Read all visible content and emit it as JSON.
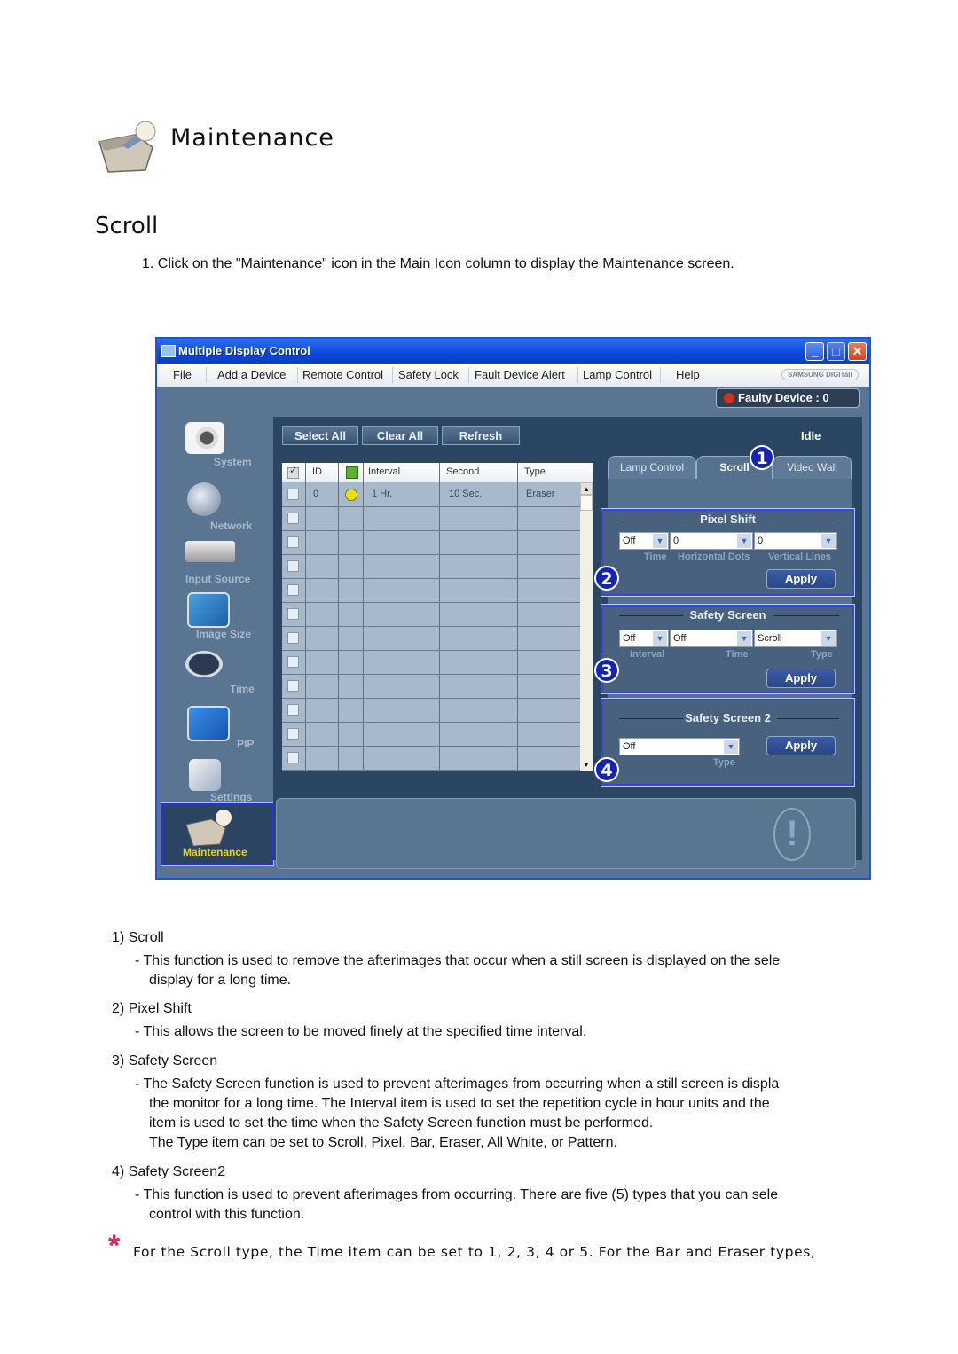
{
  "page": {
    "header_title": "Maintenance",
    "section_title": "Scroll",
    "step1": "1. Click on the \"Maintenance\" icon in the Main Icon column to display the Maintenance screen."
  },
  "window": {
    "title": "Multiple Display Control",
    "controls": {
      "minimize": "_",
      "maximize": "□",
      "close": "✕"
    },
    "menu": [
      "File",
      "Add a Device",
      "Remote Control",
      "Safety Lock",
      "Fault Device Alert",
      "Lamp Control",
      "Help"
    ],
    "brand": "SAMSUNG DIGITall",
    "faulty_device": "Faulty Device : 0",
    "status": "Idle",
    "nav": [
      {
        "label": "System",
        "icon": "system-icon"
      },
      {
        "label": "Network",
        "icon": "network-icon"
      },
      {
        "label": "Input Source",
        "icon": "input-source-icon"
      },
      {
        "label": "Image Size",
        "icon": "image-size-icon"
      },
      {
        "label": "Time",
        "icon": "clock-icon"
      },
      {
        "label": "PIP",
        "icon": "pip-icon"
      },
      {
        "label": "Settings",
        "icon": "settings-icon"
      },
      {
        "label": "Maintenance",
        "icon": "maintenance-icon",
        "selected": true
      }
    ],
    "toolbar": {
      "select_all": "Select All",
      "clear_all": "Clear All",
      "refresh": "Refresh"
    },
    "table": {
      "columns": [
        "ID",
        "Interval",
        "Second",
        "Type"
      ],
      "rows": [
        {
          "checked": false,
          "id": "0",
          "status": "on",
          "interval": "1  Hr.",
          "second": "10 Sec.",
          "type": "Eraser"
        }
      ],
      "empty_rows": 11
    },
    "tabs": [
      {
        "label": "Lamp Control",
        "active": false
      },
      {
        "label": "Scroll",
        "active": true
      },
      {
        "label": "Video Wall",
        "active": false
      }
    ],
    "pixel_shift": {
      "title": "Pixel Shift",
      "fields": [
        {
          "label": "Time",
          "value": "Off"
        },
        {
          "label": "Horizontal Dots",
          "value": "0"
        },
        {
          "label": "Vertical Lines",
          "value": "0"
        }
      ],
      "apply": "Apply"
    },
    "safety_screen": {
      "title": "Safety Screen",
      "fields": [
        {
          "label": "Interval",
          "value": "Off"
        },
        {
          "label": "Time",
          "value": "Off"
        },
        {
          "label": "Type",
          "value": "Scroll"
        }
      ],
      "apply": "Apply"
    },
    "safety_screen2": {
      "title": "Safety Screen 2",
      "fields": [
        {
          "label": "Type",
          "value": "Off"
        }
      ],
      "apply": "Apply"
    },
    "badges": [
      "1",
      "2",
      "3",
      "4"
    ]
  },
  "descriptions": [
    {
      "num": "1)",
      "title": "Scroll",
      "lines": [
        "-  This function is used to remove the afterimages that occur when a still screen is displayed on the sele",
        "display for a long time."
      ]
    },
    {
      "num": "2)",
      "title": "Pixel Shift",
      "lines": [
        "-  This allows the screen to be moved finely at the specified time interval."
      ]
    },
    {
      "num": "3)",
      "title": "Safety Screen",
      "lines": [
        "-  The Safety Screen function is used to prevent afterimages from occurring when a still screen is displa",
        "the monitor for a long time.  The Interval item is used to set the repetition cycle in hour units and the",
        "item is used to set the time when the Safety Screen function must be performed.",
        "The Type item can be set to Scroll, Pixel, Bar, Eraser, All White, or Pattern."
      ]
    },
    {
      "num": "4)",
      "title": "Safety Screen2",
      "lines": [
        "-  This function is used to prevent afterimages from occurring. There are five (5) types that you can sele",
        "control with this function."
      ]
    }
  ],
  "note": {
    "marker": "*",
    "text": "For the Scroll type, the Time item can be set to 1, 2, 3, 4 or 5. For the Bar and Eraser types,"
  }
}
